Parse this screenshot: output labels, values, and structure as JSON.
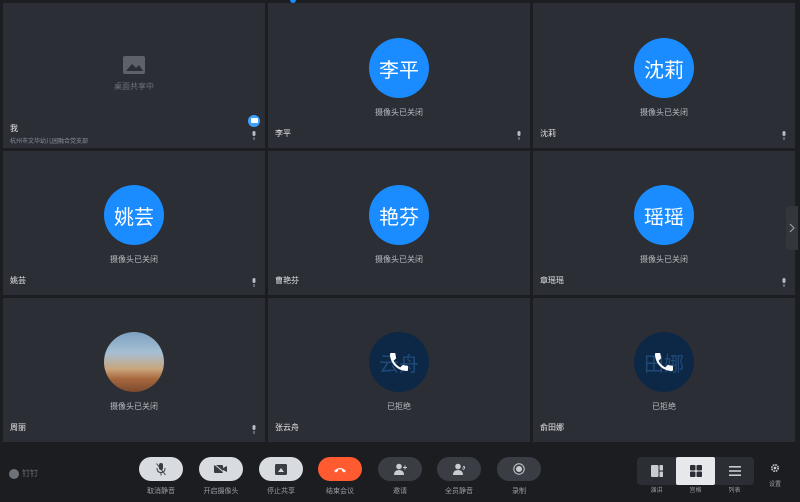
{
  "tiles": [
    {
      "type": "share",
      "share_text": "桌面共享中",
      "name": "我",
      "subtitle": "杭州市文华幼儿园融合党支部"
    },
    {
      "type": "avatar",
      "avatar": "李平",
      "status": "摄像头已关闭",
      "name": "李平"
    },
    {
      "type": "avatar",
      "avatar": "沈莉",
      "status": "摄像头已关闭",
      "name": "沈莉"
    },
    {
      "type": "avatar",
      "avatar": "姚芸",
      "status": "摄像头已关闭",
      "name": "姚芸"
    },
    {
      "type": "avatar",
      "avatar": "艳芬",
      "status": "摄像头已关闭",
      "name": "曹艳芬"
    },
    {
      "type": "avatar",
      "avatar": "瑶瑶",
      "status": "摄像头已关闭",
      "name": "章瑶瑶"
    },
    {
      "type": "photo",
      "status": "摄像头已关闭",
      "name": "周丽"
    },
    {
      "type": "declined",
      "avatar": "云舟",
      "status": "已拒绝",
      "name": "张云舟"
    },
    {
      "type": "declined",
      "avatar": "田娜",
      "status": "已拒绝",
      "name": "俞田娜"
    }
  ],
  "brand": {
    "label": "钉钉"
  },
  "controls": {
    "unmute": "取消静音",
    "camera": "开启摄像头",
    "stop_share": "停止共享",
    "end": "结束会议",
    "invite": "邀请",
    "mute_all": "全员静音",
    "record": "录制"
  },
  "layouts": {
    "speaker": "演讲",
    "gallery": "宫格",
    "list": "列表"
  },
  "settings": {
    "label": "设置"
  },
  "colors": {
    "accent": "#1a8cff",
    "end_call": "#ff5a30",
    "tile_bg": "#2b2e34"
  }
}
